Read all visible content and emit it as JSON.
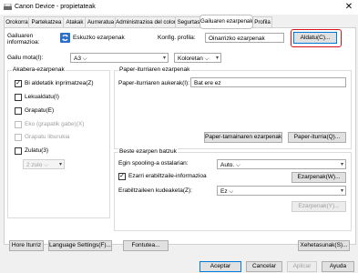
{
  "window": {
    "title": "Canon Device - propietateak",
    "close_glyph": "✕"
  },
  "tabs": [
    {
      "label": "Orokorra"
    },
    {
      "label": "Partekatzea"
    },
    {
      "label": "Atakak"
    },
    {
      "label": "Aurreratua"
    },
    {
      "label": "Administrazioa del color"
    },
    {
      "label": "Segurtas"
    },
    {
      "label": "Gailuaren ezarpenak"
    },
    {
      "label": "Profila"
    }
  ],
  "top": {
    "device_info_label": "Gailuaren\ninformazioa:",
    "manual_config_label": "Eskuzko ezarpenak",
    "config_profile_label": "Konfig. profila:",
    "config_profile_value": "Oinarrizko ezarpenak",
    "change_button": "Aldatu(C)..."
  },
  "model": {
    "label": "Gailu mota(I):",
    "size_value": "A3",
    "color_value": "Koloretan"
  },
  "finishing": {
    "title": "Akabera-ezarpenak",
    "items": [
      {
        "label": "Bi aldetatik inprimatzea(Z)",
        "checked": true,
        "disabled": false
      },
      {
        "label": "Lekualdatu(I)",
        "checked": false,
        "disabled": false
      },
      {
        "label": "Grapatu(E)",
        "checked": false,
        "disabled": false
      },
      {
        "label": "Eko (grapatik gabe)(X)",
        "checked": false,
        "disabled": true
      },
      {
        "label": "Grapatu liburukia",
        "checked": false,
        "disabled": true
      },
      {
        "label": "Zulatu(3)",
        "checked": false,
        "disabled": false
      }
    ],
    "hole_select": "2 zulo"
  },
  "paper_source": {
    "title": "Paper-iturriaren ezarpenak",
    "option_label": "Paper-iturriaren aukerak(I):",
    "option_value": "Bat ere ez",
    "size_button": "Paper-tamainaren ezarpenak(K)...",
    "source_button": "Paper-iturria(Q)..."
  },
  "other": {
    "title": "Beste ezarpen batzuk",
    "spool_label": "Egin spooling-a ostalarian:",
    "spool_value": "Auto.",
    "auth_label": "Ezarri erabiltzaile-informazioa",
    "auth_checked": true,
    "settings_button": "Ezarpenak(W)...",
    "user_mgmt_label": "Erabiltzaileen kudeaketa(Z):",
    "user_mgmt_value": "Ez",
    "user_settings_button": "Ezarpenak(Y)..."
  },
  "panel_buttons": {
    "font_list": "Hore Iturriz",
    "language": "Language Settings(F)...",
    "fonts": "Fontutea...",
    "restore": "Xehetasunak(S)..."
  },
  "dialog_buttons": {
    "ok": "Aceptar",
    "cancel": "Cancelar",
    "apply": "Aplicar",
    "help": "Ayuda"
  },
  "colors": {
    "highlight_red": "#d8101a",
    "accent_blue": "#0078d7"
  }
}
